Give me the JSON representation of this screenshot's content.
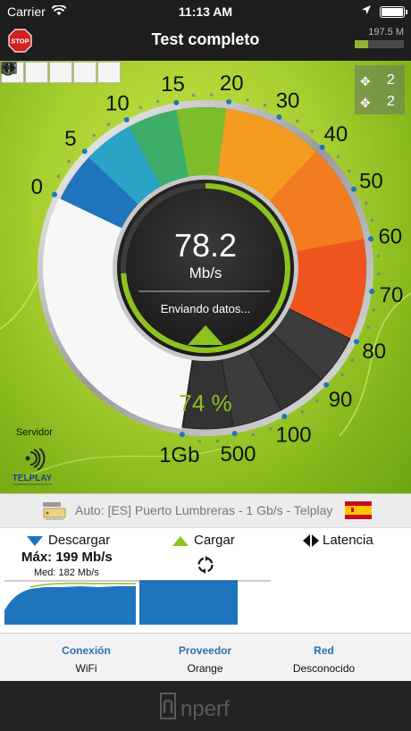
{
  "status_bar": {
    "carrier": "Carrier",
    "time": "11:13 AM",
    "battery_level": 1.0
  },
  "header": {
    "title": "Test completo",
    "stop_label": "STOP",
    "memory_label": "197.5 M",
    "memory_fill": 0.28
  },
  "toolbar": {
    "buttons": [
      "download-view",
      "upload-view",
      "latency-view",
      "globe",
      "video"
    ]
  },
  "connections": {
    "rows": [
      {
        "icon": "fan-icon",
        "value": "2"
      },
      {
        "icon": "fan-icon",
        "value": "2"
      }
    ]
  },
  "gauge": {
    "scale_labels": [
      "0",
      "5",
      "10",
      "15",
      "20",
      "30",
      "40",
      "50",
      "60",
      "70",
      "80",
      "90",
      "100",
      "500",
      "1Gb"
    ],
    "speed_value": "78.2",
    "unit": "Mb/s",
    "status_text": "Enviando datos...",
    "progress": "74 %",
    "progress_fraction": 0.74,
    "colors": {
      "accent_green": "#8dc21f",
      "orange": "#f49b22",
      "red": "#f0541e",
      "blue": "#1f75bd",
      "dark": "#2a2a2a"
    }
  },
  "server": {
    "section_label": "Servidor",
    "logo_text": "TELPLAY",
    "description": "Auto: [ES] Puerto Lumbreras - 1 Gb/s - Telplay",
    "country_flag": "ES"
  },
  "results": {
    "download_label": "Descargar",
    "upload_label": "Cargar",
    "latency_label": "Latencia",
    "max_label": "Máx: 199 Mb/s",
    "med_label": "Med: 182 Mb/s"
  },
  "info": {
    "connection_label": "Conexión",
    "connection_value": "WiFi",
    "provider_label": "Proveedor",
    "provider_value": "Orange",
    "network_label": "Red",
    "network_value": "Desconocido"
  },
  "footer": {
    "brand": "nperf"
  }
}
